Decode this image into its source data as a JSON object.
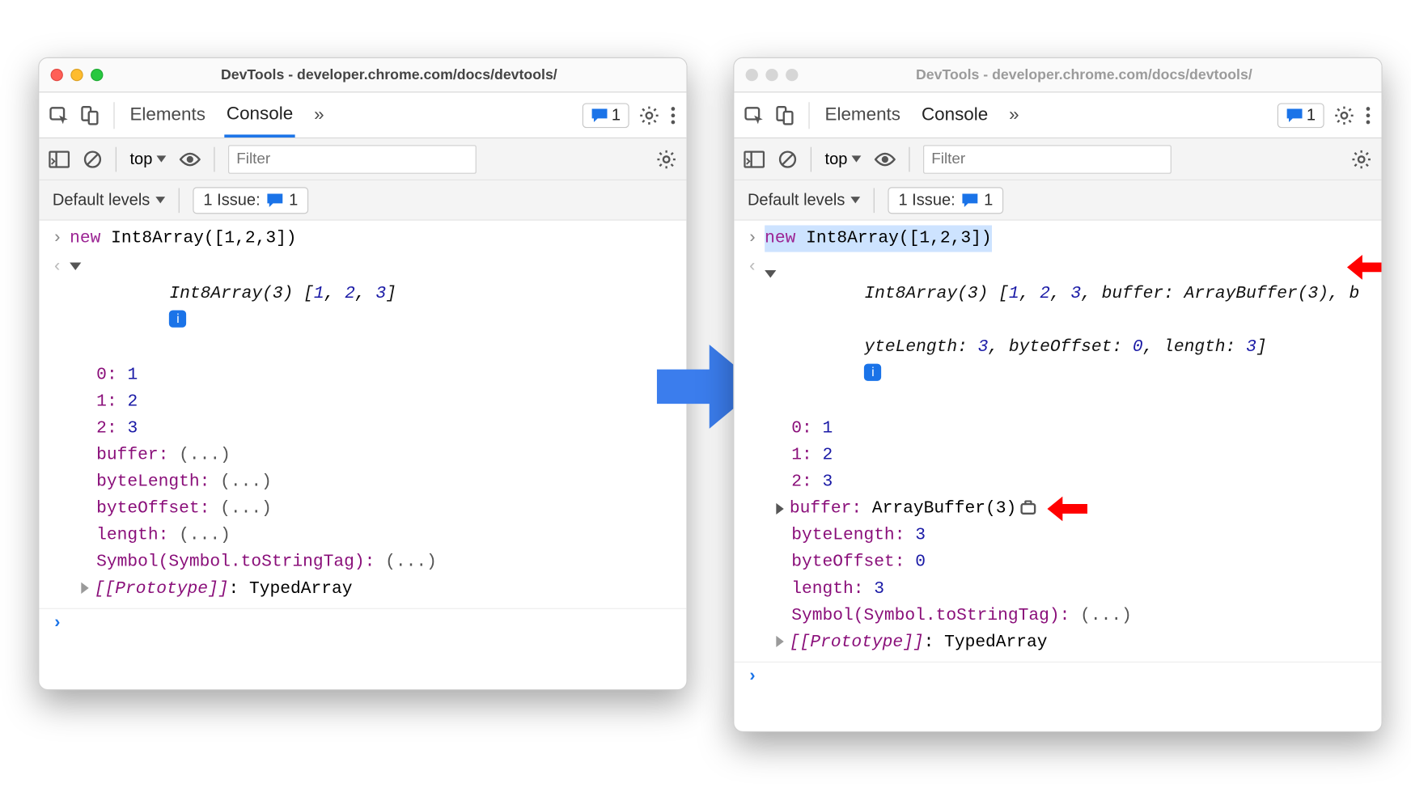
{
  "leftWindow": {
    "title": "DevTools - developer.chrome.com/docs/devtools/",
    "tabs": {
      "elements": "Elements",
      "console": "Console",
      "more": "»"
    },
    "msgCount": "1",
    "context": "top",
    "filterPlaceholder": "Filter",
    "levels": "Default levels",
    "issuesLabel": "1 Issue:",
    "issuesCount": "1",
    "input": "new Int8Array([1,2,3])",
    "inputKw": "new",
    "inputRest": " Int8Array([1,2,3])",
    "preview": "Int8Array(3) [1, 2, 3]",
    "lines": {
      "l0k": "0",
      "l0v": "1",
      "l1k": "1",
      "l1v": "2",
      "l2k": "2",
      "l2v": "3",
      "l3k": "buffer",
      "l3v": "(...)",
      "l4k": "byteLength",
      "l4v": "(...)",
      "l5k": "byteOffset",
      "l5v": "(...)",
      "l6k": "length",
      "l6v": "(...)",
      "l7k": "Symbol(Symbol.toStringTag)",
      "l7v": "(...)",
      "l8k": "[[Prototype]]",
      "l8v": "TypedArray"
    }
  },
  "rightWindow": {
    "title": "DevTools - developer.chrome.com/docs/devtools/",
    "tabs": {
      "elements": "Elements",
      "console": "Console",
      "more": "»"
    },
    "msgCount": "1",
    "context": "top",
    "filterPlaceholder": "Filter",
    "levels": "Default levels",
    "issuesLabel": "1 Issue:",
    "issuesCount": "1",
    "inputKw": "new",
    "inputRest": " Int8Array([1,2,3])",
    "previewP1": "Int8Array(3) [",
    "previewNums": "1, 2, 3",
    "previewP2": ", buffer: ArrayBuffer(3), b",
    "previewLine2a": "yteLength: ",
    "previewLine2v1": "3",
    "previewLine2b": ", byteOffset: ",
    "previewLine2v2": "0",
    "previewLine2c": ", length: ",
    "previewLine2v3": "3",
    "previewLine2d": "]",
    "lines": {
      "l0k": "0",
      "l0v": "1",
      "l1k": "1",
      "l1v": "2",
      "l2k": "2",
      "l2v": "3",
      "l3k": "buffer",
      "l3v": "ArrayBuffer(3)",
      "l4k": "byteLength",
      "l4v": "3",
      "l5k": "byteOffset",
      "l5v": "0",
      "l6k": "length",
      "l6v": "3",
      "l7k": "Symbol(Symbol.toStringTag)",
      "l7v": "(...)",
      "l8k": "[[Prototype]]",
      "l8v": "TypedArray"
    }
  }
}
